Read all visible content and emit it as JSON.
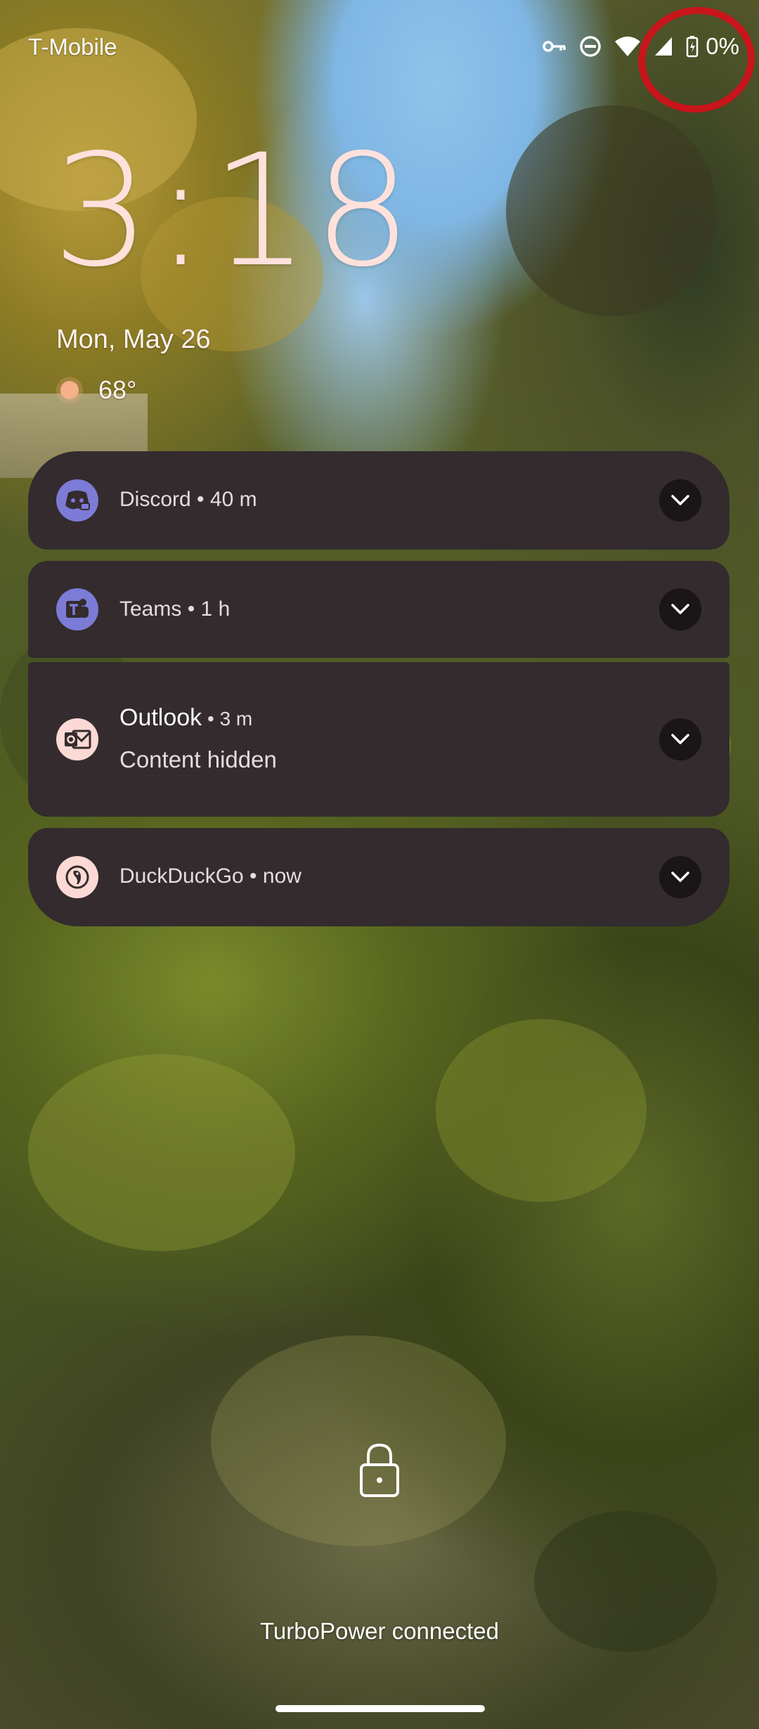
{
  "status_bar": {
    "carrier": "T-Mobile",
    "battery_percent": "0%",
    "icons": [
      "vpn-key-icon",
      "do-not-disturb-icon",
      "wifi-icon",
      "cell-signal-icon",
      "battery-charging-icon"
    ]
  },
  "lockscreen": {
    "time": "3:18",
    "date": "Mon, May 26",
    "weather": {
      "icon": "sun-icon",
      "temperature": "68°"
    }
  },
  "notifications": [
    {
      "app": "Discord",
      "time": "40 m",
      "icon": "discord-icon"
    },
    {
      "app": "Teams",
      "time": "1 h",
      "icon": "teams-icon"
    },
    {
      "app": "Outlook",
      "time": "3 m",
      "body": "Content hidden",
      "icon": "outlook-icon"
    },
    {
      "app": "DuckDuckGo",
      "time": "now",
      "icon": "duckduckgo-icon"
    }
  ],
  "separator": " • ",
  "bottom": {
    "charging_text": "TurboPower connected"
  },
  "colors": {
    "notification_bg": "#332b2e",
    "clock": "#ffe1dc",
    "annotation": "#c8141b",
    "discord_teams_icon": "#7c7bd6",
    "outlook_duck_icon": "#fcd9d4"
  }
}
